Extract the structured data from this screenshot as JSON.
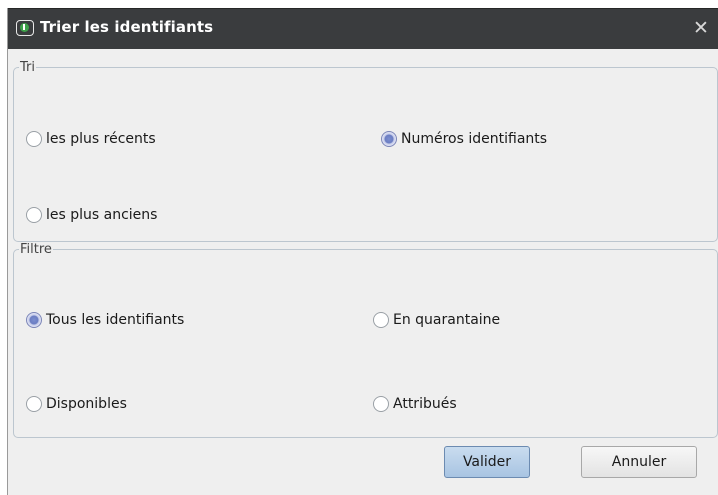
{
  "dialog": {
    "title": "Trier les identifiants",
    "title_icon": "id-card-icon",
    "close_symbol": "✕"
  },
  "tri": {
    "legend": "Tri",
    "options": [
      {
        "label": "les plus récents",
        "selected": false
      },
      {
        "label": "Numéros identifiants",
        "selected": true
      },
      {
        "label": "les plus anciens",
        "selected": false
      }
    ]
  },
  "filtre": {
    "legend": "Filtre",
    "options": [
      {
        "label": "Tous les identifiants",
        "selected": true
      },
      {
        "label": "En quarantaine",
        "selected": false
      },
      {
        "label": "Disponibles",
        "selected": false
      },
      {
        "label": "Attribués",
        "selected": false
      }
    ]
  },
  "buttons": {
    "validate_label": "Valider",
    "cancel_label": "Annuler"
  },
  "colors": {
    "titlebar": "#3a3c3e",
    "dialog_bg": "#efefef",
    "selected_radio": "#6b7dc2",
    "primary_button": "#b8d0ea"
  }
}
